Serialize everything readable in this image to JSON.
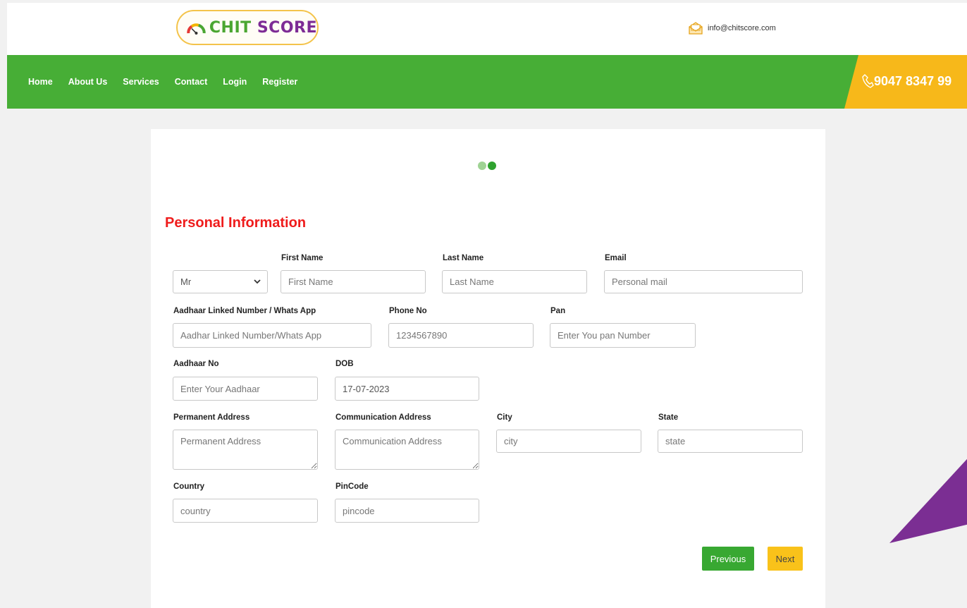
{
  "header": {
    "logo": {
      "word1": "CHIT",
      "word2": "SCORE"
    },
    "email": "info@chitscore.com",
    "icons": {
      "email": "envelope-icon",
      "phone": "phone-icon"
    }
  },
  "nav": {
    "items": [
      "Home",
      "About Us",
      "Services",
      "Contact",
      "Login",
      "Register"
    ],
    "phone": "9047 8347 99"
  },
  "stepper": {
    "total": 2,
    "current": 2
  },
  "form": {
    "title": "Personal Information",
    "salutation": {
      "selected": "Mr"
    },
    "first_name": {
      "label": "First Name",
      "placeholder": "First Name"
    },
    "last_name": {
      "label": "Last Name",
      "placeholder": "Last Name"
    },
    "email": {
      "label": "Email",
      "placeholder": "Personal mail"
    },
    "aadhaar_linked": {
      "label": "Aadhaar Linked Number / Whats App",
      "placeholder": "Aadhar Linked Number/Whats App"
    },
    "phone": {
      "label": "Phone No",
      "placeholder": "1234567890"
    },
    "pan": {
      "label": "Pan",
      "placeholder": "Enter You pan Number"
    },
    "aadhaar_no": {
      "label": "Aadhaar No",
      "placeholder": "Enter Your Aadhaar"
    },
    "dob": {
      "label": "DOB",
      "value": "17-07-2023"
    },
    "permanent_address": {
      "label": "Permanent Address",
      "placeholder": "Permanent Address"
    },
    "communication_address": {
      "label": "Communication Address",
      "placeholder": "Communication Address"
    },
    "city": {
      "label": "City",
      "placeholder": "city"
    },
    "state": {
      "label": "State",
      "placeholder": "state"
    },
    "country": {
      "label": "Country",
      "placeholder": "country"
    },
    "pincode": {
      "label": "PinCode",
      "placeholder": "pincode"
    },
    "buttons": {
      "previous": "Previous",
      "next": "Next"
    }
  },
  "colors": {
    "nav_green": "#47ae36",
    "phone_yellow": "#f7b81a",
    "title_red": "#ef1c1c",
    "prev_button": "#38a832",
    "next_button": "#f9c21a",
    "accent_purple": "#7b2e93"
  }
}
